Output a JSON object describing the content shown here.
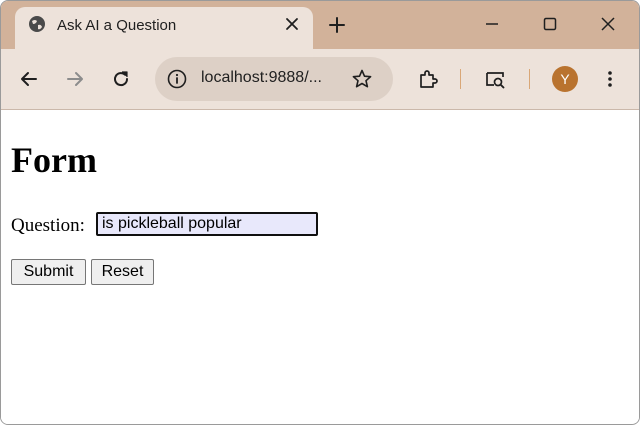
{
  "browser": {
    "tab": {
      "title": "Ask AI a Question",
      "favicon": "globe-icon"
    },
    "address_bar": {
      "url": "localhost:9888/..."
    },
    "profile_initial": "Y",
    "colors": {
      "tab_strip": "#d2b29a",
      "toolbar": "#ede2da",
      "omnibox": "#ddd0c6",
      "avatar": "#b9732f"
    },
    "icons": [
      "globe-icon",
      "close-icon",
      "plus-icon",
      "minimize-icon",
      "maximize-icon",
      "back-arrow-icon",
      "forward-arrow-icon",
      "reload-icon",
      "info-icon",
      "star-icon",
      "extensions-icon",
      "search-tab-icon",
      "more-vertical-icon"
    ]
  },
  "page": {
    "heading": "Form",
    "form": {
      "question_label": "Question:",
      "question_value": "is pickleball popular",
      "submit_label": "Submit",
      "reset_label": "Reset"
    }
  }
}
